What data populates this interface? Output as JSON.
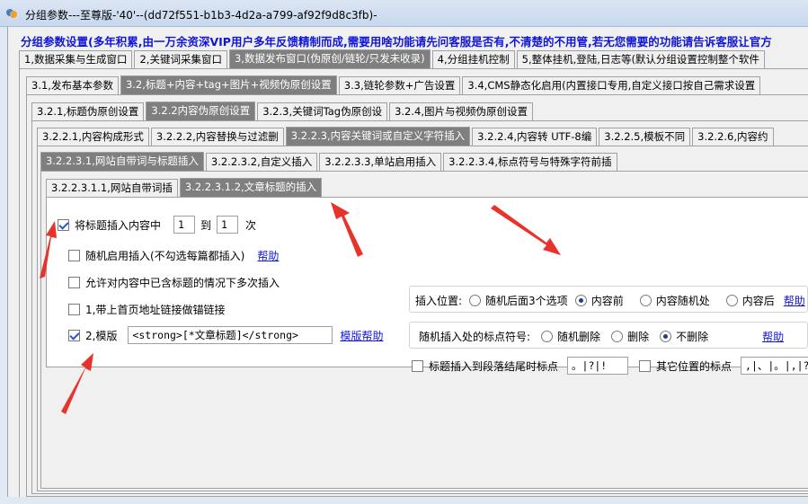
{
  "window": {
    "title": "分组参数---至尊版-'40'--(dd72f551-b1b3-4d2a-a799-af92f9d8c3fb)-"
  },
  "notice": "分组参数设置(多年积累,由一万余资深VIP用户多年反馈精制而成,需要用啥功能请先问客服是否有,不清楚的不用管,若无您需要的功能请告诉客服让官方",
  "tabs_l1": [
    {
      "label": "1,数据采集与生成窗口"
    },
    {
      "label": "2,关键词采集窗口"
    },
    {
      "label": "3,数据发布窗口(伪原创/链轮/只发未收录)"
    },
    {
      "label": "4,分组挂机控制"
    },
    {
      "label": "5,整体挂机,登陆,日志等(默认分组设置控制整个软件"
    }
  ],
  "tabs_l2": [
    {
      "label": "3.1,发布基本参数"
    },
    {
      "label": "3.2,标题+内容+tag+图片+视频伪原创设置"
    },
    {
      "label": "3.3,链轮参数+广告设置"
    },
    {
      "label": "3.4,CMS静态化启用(内置接口专用,自定义接口按自己需求设置"
    }
  ],
  "tabs_l3": [
    {
      "label": "3.2.1,标题伪原创设置"
    },
    {
      "label": "3.2.2内容伪原创设置"
    },
    {
      "label": "3.2.3,关键词Tag伪原创设"
    },
    {
      "label": "3.2.4,图片与视频伪原创设置"
    }
  ],
  "tabs_l4": [
    {
      "label": "3.2.2.1,内容构成形式"
    },
    {
      "label": "3.2.2.2,内容替换与过滤删"
    },
    {
      "label": "3.2.2.3,内容关键词或自定义字符插入"
    },
    {
      "label": "3.2.2.4,内容转 UTF-8编"
    },
    {
      "label": "3.2.2.5,模板不同"
    },
    {
      "label": "3.2.2.6,内容约"
    }
  ],
  "tabs_l5": [
    {
      "label": "3.2.2.3.1,网站自带词与标题插入"
    },
    {
      "label": "3.2.2.3.2,自定义插入"
    },
    {
      "label": "3.2.2.3.3,单站启用插入"
    },
    {
      "label": "3.2.2.3.4,标点符号与特殊字符前插"
    }
  ],
  "tabs_l6": [
    {
      "label": "3.2.2.3.1.1,网站自带词插"
    },
    {
      "label": "3.2.2.3.1.2,文章标题的插入"
    }
  ],
  "options": {
    "insert_title": {
      "label": "将标题插入内容中",
      "checked": true,
      "from": "1",
      "to_label": "到",
      "to": "1",
      "unit": "次"
    },
    "random_insert": {
      "label": "随机启用插入(不勾选每篇都插入)",
      "checked": false,
      "help": "帮助"
    },
    "allow_multi": {
      "label": "允许对内容中已含标题的情况下多次插入",
      "checked": false
    },
    "homepage_anchor": {
      "label": "1,带上首页地址链接做锚链接",
      "checked": false
    },
    "template": {
      "label": "2,模版",
      "checked": true,
      "value": "<strong>[*文章标题]</strong>",
      "help": "模版帮助"
    }
  },
  "position": {
    "label": "插入位置:",
    "options": [
      "随机后面3个选项",
      "内容前",
      "内容随机处",
      "内容后"
    ],
    "selected": "内容前",
    "help": "帮助"
  },
  "punct": {
    "label": "随机插入处的标点符号:",
    "options": [
      "随机删除",
      "删除",
      "不删除"
    ],
    "selected": "不删除",
    "help": "帮助"
  },
  "para_end": {
    "label": "标题插入到段落结尾时标点",
    "checked": false,
    "value": "。|?|!"
  },
  "other_pos": {
    "label": "其它位置的标点",
    "checked": false,
    "value": ",|、|。|,|?"
  },
  "colors": {
    "active_tab": "#7f7f7f",
    "notice": "#1016d8",
    "arrow": "#e8322c"
  }
}
